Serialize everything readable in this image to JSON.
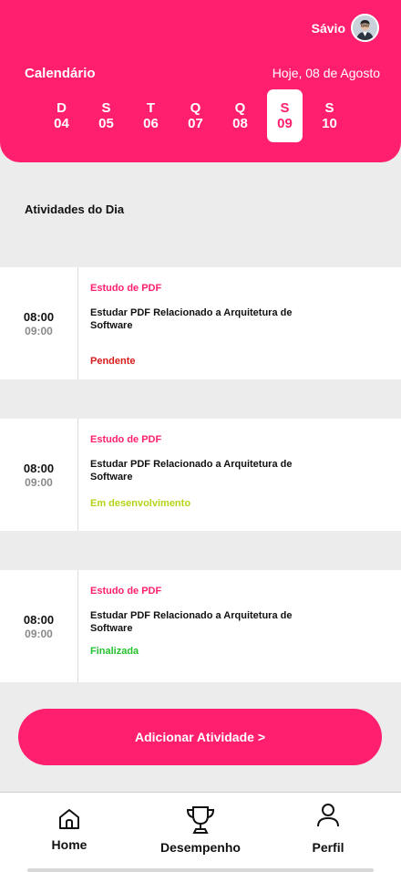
{
  "header": {
    "user_name": "Sávio",
    "calendar_title": "Calendário",
    "today_label": "Hoje, 08 de Agosto",
    "days": [
      {
        "letter": "D",
        "number": "04",
        "selected": false
      },
      {
        "letter": "S",
        "number": "05",
        "selected": false
      },
      {
        "letter": "T",
        "number": "06",
        "selected": false
      },
      {
        "letter": "Q",
        "number": "07",
        "selected": false
      },
      {
        "letter": "Q",
        "number": "08",
        "selected": false
      },
      {
        "letter": "S",
        "number": "09",
        "selected": true
      },
      {
        "letter": "S",
        "number": "10",
        "selected": false
      }
    ]
  },
  "section_title": "Atividades do Dia",
  "activities": [
    {
      "start": "08:00",
      "end": "09:00",
      "category": "Estudo de PDF",
      "description": "Estudar PDF Relacionado a Arquitetura de Software",
      "status": "Pendente",
      "status_color": "#d81b1b"
    },
    {
      "start": "08:00",
      "end": "09:00",
      "category": "Estudo de PDF",
      "description": "Estudar PDF Relacionado a Arquitetura de Software",
      "status": "Em desenvolvimento",
      "status_color": "#b5d418"
    },
    {
      "start": "08:00",
      "end": "09:00",
      "category": "Estudo de PDF",
      "description": "Estudar PDF Relacionado a Arquitetura de Software",
      "status": "Finalizada",
      "status_color": "#25c12f"
    }
  ],
  "add_button_label": "Adicionar Atividade >",
  "nav": {
    "home": {
      "label": "Home",
      "icon": "home-icon"
    },
    "desempenho": {
      "label": "Desempenho",
      "icon": "trophy-icon"
    },
    "perfil": {
      "label": "Perfil",
      "icon": "user-icon"
    }
  },
  "colors": {
    "accent": "#ff1f6e",
    "background": "#ececec"
  }
}
